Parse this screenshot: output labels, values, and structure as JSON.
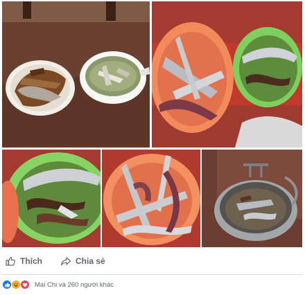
{
  "actions": {
    "like_label": "Thích",
    "share_label": "Chia sẻ"
  },
  "reactions": {
    "icons": [
      "like-icon",
      "haha-icon",
      "love-icon"
    ],
    "colors": {
      "like": "#1877f2",
      "haha": "#f7b125",
      "love": "#f33e58"
    },
    "summary": "Mai Chi và 260 người khác"
  },
  "photos": [
    {
      "name": "photo-fish-plate-and-soup"
    },
    {
      "name": "photo-fish-baskets"
    },
    {
      "name": "photo-green-basket"
    },
    {
      "name": "photo-orange-basket"
    },
    {
      "name": "photo-cooking-pot"
    }
  ]
}
